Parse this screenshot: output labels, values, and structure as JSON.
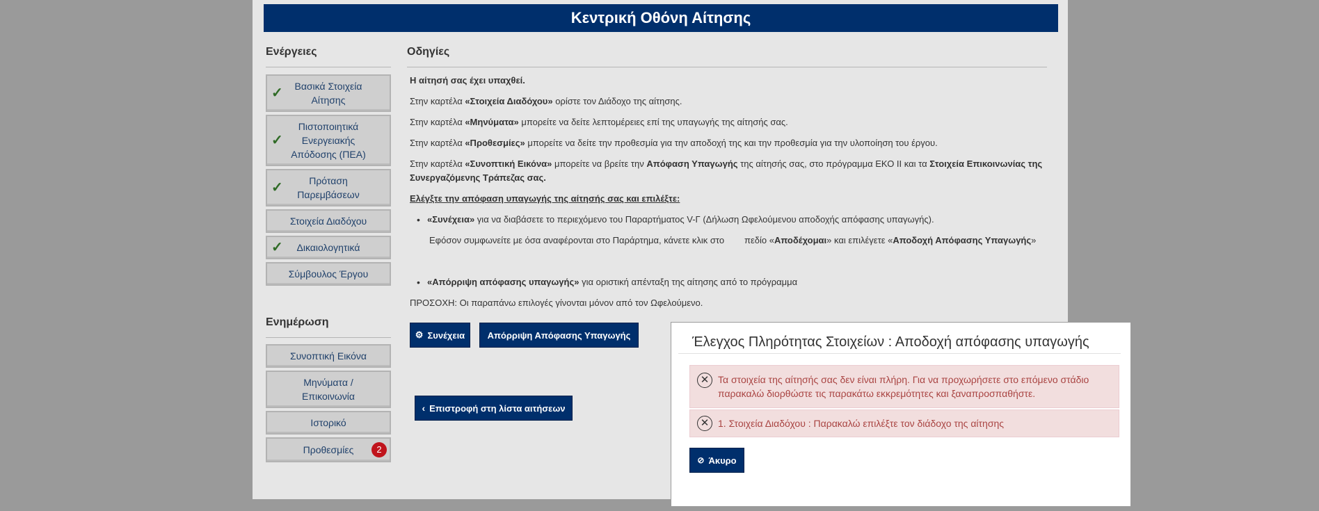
{
  "header": {
    "title": "Κεντρική Οθόνη Αίτησης"
  },
  "sidebar": {
    "actions_title": "Ενέργειες",
    "actions": [
      {
        "label": "Βασικά Στοιχεία Αίτησης",
        "checked": true
      },
      {
        "label": "Πιστοποιητικά Ενεργειακής Απόδοσης (ΠΕΑ)",
        "checked": true
      },
      {
        "label": "Πρόταση Παρεμβάσεων",
        "checked": true
      },
      {
        "label": "Στοιχεία Διαδόχου",
        "checked": false
      },
      {
        "label": "Δικαιολογητικά",
        "checked": true
      },
      {
        "label": "Σύμβουλος Έργου",
        "checked": false
      }
    ],
    "info_title": "Ενημέρωση",
    "info": [
      {
        "label": "Συνοπτική Εικόνα"
      },
      {
        "label": "Μηνύματα / Επικοινωνία"
      },
      {
        "label": "Ιστορικό"
      },
      {
        "label": "Προθεσμίες",
        "badge": "2"
      }
    ]
  },
  "instructions": {
    "title": "Οδηγίες",
    "submitted": "Η αίτησή σας έχει υπαχθεί.",
    "p1": {
      "pre": "Στην καρτέλα ",
      "tab": "«Στοιχεία Διαδόχου»",
      "post": " ορίστε τον Διάδοχο της αίτησης."
    },
    "p2": {
      "pre": "Στην καρτέλα ",
      "tab": "«Μηνύματα»",
      "post": " μπορείτε να δείτε λεπτομέρειες επί της υπαγωγής της αίτησής σας."
    },
    "p3": {
      "pre": "Στην καρτέλα ",
      "tab": "«Προθεσμίες»",
      "post": " μπορείτε να δείτε την προθεσμία για την αποδοχή της και την προθεσμία για την υλοποίηση του έργου."
    },
    "p4": {
      "pre": "Στην καρτέλα ",
      "tab": "«Συνοπτική Εικόνα»",
      "mid1": " μπορείτε να βρείτε την ",
      "b1": "Απόφαση Υπαγωγής",
      "mid2": " της αίτησής σας, στο πρόγραμμα ΕΚΟ ΙΙ και τα ",
      "b2": "Στοιχεία Επικοινωνίας της Συνεργαζόμενης Τράπεζας σας."
    },
    "check_heading": "Ελέγξτε την απόφαση υπαγωγής της αίτησής σας και επιλέξτε:",
    "bullet1": {
      "b": "«Συνέχεια»",
      "post": " για να διαβάσετε το περιεχόμενο του Παραρτήματος V-Γ (Δήλωση Ωφελούμενου αποδοχής απόφασης υπαγωγής)."
    },
    "bullet1_sub": {
      "pre": "Εφόσον συμφωνείτε με όσα αναφέρονται στο Παράρτημα, κάνετε κλικ στο        πεδίο «",
      "b1": "Αποδέχομαι",
      "mid": "» και επιλέγετε «",
      "b2": "Αποδοχή Απόφασης Υπαγωγής",
      "post": "»"
    },
    "bullet2": {
      "b": "«Απόρριψη απόφασης υπαγωγής»",
      "post": " για οριστική απένταξη της αίτησης από το πρόγραμμα"
    },
    "warning": "ΠΡΟΣΟΧΗ: Οι παραπάνω επιλογές γίνονται μόνον από τον Ωφελούμενο."
  },
  "buttons": {
    "continue": "Συνέχεια",
    "reject": "Απόρριψη Απόφασης Υπαγωγής",
    "back": "Επιστροφή στη λίστα αιτήσεων"
  },
  "modal": {
    "title": "Έλεγχος Πληρότητας Στοιχείων : Αποδοχή απόφασης υπαγωγής",
    "alert1": "Τα στοιχεία της αίτησής σας δεν είναι πλήρη. Για να προχωρήσετε στο επόμενο στάδιο παρακαλώ διορθώστε τις παρακάτω εκκρεμότητες και ξαναπροσπαθήστε.",
    "alert2": "1. Στοιχεία Διαδόχου : Παρακαλώ επιλέξτε τον διάδοχο της αίτησης",
    "cancel": "Άκυρο"
  }
}
